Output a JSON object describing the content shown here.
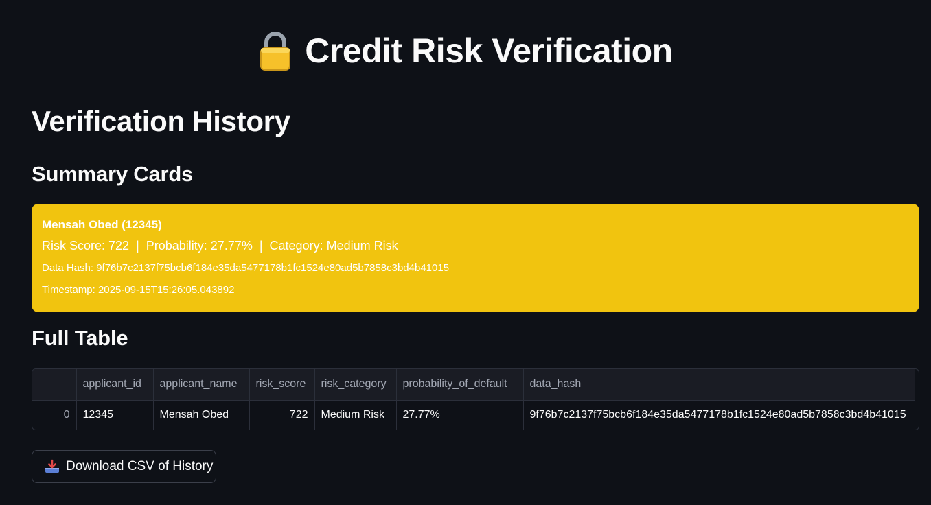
{
  "app": {
    "title": "Credit Risk Verification",
    "title_icon": "lock-icon"
  },
  "sections": {
    "history_title": "Verification History",
    "summary_title": "Summary Cards",
    "table_title": "Full Table"
  },
  "card": {
    "background": "#f1c40f",
    "name_line": "Mensah Obed (12345)",
    "risk_score": "Risk Score: 722",
    "probability": "Probability: 27.77%",
    "category": "Category: Medium Risk",
    "separator": "|",
    "data_hash": "Data Hash: 9f76b7c2137f75bcb6f184e35da5477178b1fc1524e80ad5b7858c3bd4b41015",
    "timestamp": "Timestamp: 2025-09-15T15:26:05.043892"
  },
  "table": {
    "columns": [
      "",
      "applicant_id",
      "applicant_name",
      "risk_score",
      "risk_category",
      "probability_of_default",
      "data_hash"
    ],
    "rows": [
      [
        "0",
        "12345",
        "Mensah Obed",
        "722",
        "Medium Risk",
        "27.77%",
        "9f76b7c2137f75bcb6f184e35da5477178b1fc1524e80ad5b7858c3bd4b41015"
      ]
    ]
  },
  "download": {
    "label": "Download CSV of History",
    "icon": "download-tray-icon"
  }
}
